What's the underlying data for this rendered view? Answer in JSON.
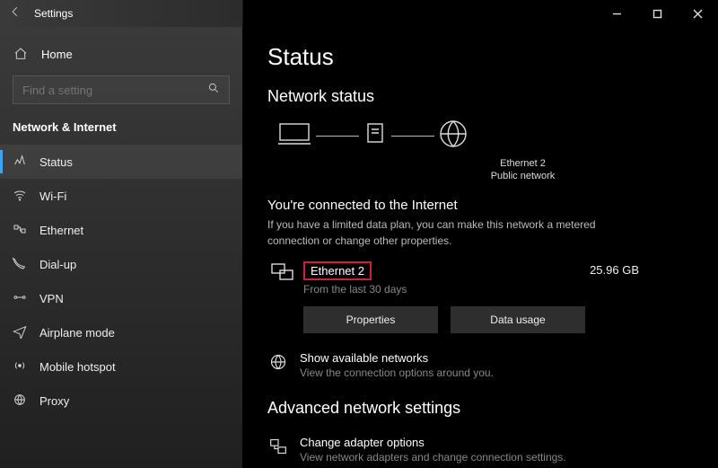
{
  "window": {
    "title": "Settings"
  },
  "sidebar": {
    "home": "Home",
    "search_placeholder": "Find a setting",
    "section": "Network & Internet",
    "items": [
      {
        "label": "Status"
      },
      {
        "label": "Wi-Fi"
      },
      {
        "label": "Ethernet"
      },
      {
        "label": "Dial-up"
      },
      {
        "label": "VPN"
      },
      {
        "label": "Airplane mode"
      },
      {
        "label": "Mobile hotspot"
      },
      {
        "label": "Proxy"
      }
    ]
  },
  "page": {
    "title": "Status",
    "network_status": "Network status",
    "diagram": {
      "adapter": "Ethernet 2",
      "adapter_type": "Public network"
    },
    "connected_heading": "You're connected to the Internet",
    "connected_sub": "If you have a limited data plan, you can make this network a metered connection or change other properties.",
    "connection": {
      "name": "Ethernet 2",
      "period": "From the last 30 days",
      "usage": "25.96 GB",
      "btn_properties": "Properties",
      "btn_data_usage": "Data usage"
    },
    "show_networks": {
      "title": "Show available networks",
      "sub": "View the connection options around you."
    },
    "advanced_heading": "Advanced network settings",
    "adapter_options": {
      "title": "Change adapter options",
      "sub": "View network adapters and change connection settings."
    }
  }
}
